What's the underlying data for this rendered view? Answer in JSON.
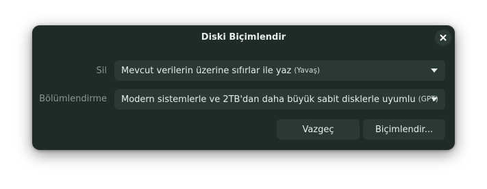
{
  "dialog": {
    "title": "Diski Biçimlendir",
    "close_icon": "close-icon"
  },
  "erase": {
    "label": "Sil",
    "value_main": "Mevcut verilerin üzerine sıfırlar ile yaz",
    "value_sub": "(Yavaş)"
  },
  "partitioning": {
    "label": "Bölümlendirme",
    "value_main": "Modern sistemlerle ve 2TB'dan daha büyük sabit disklerle uyumlu",
    "value_sub": "(GPT)"
  },
  "buttons": {
    "cancel": "Vazgeç",
    "format": "Biçimlendir..."
  },
  "colors": {
    "dialog_bg": "#1e2b27",
    "control_bg": "#2b3935",
    "text": "#e6ece9",
    "label_text": "#8a9692"
  }
}
